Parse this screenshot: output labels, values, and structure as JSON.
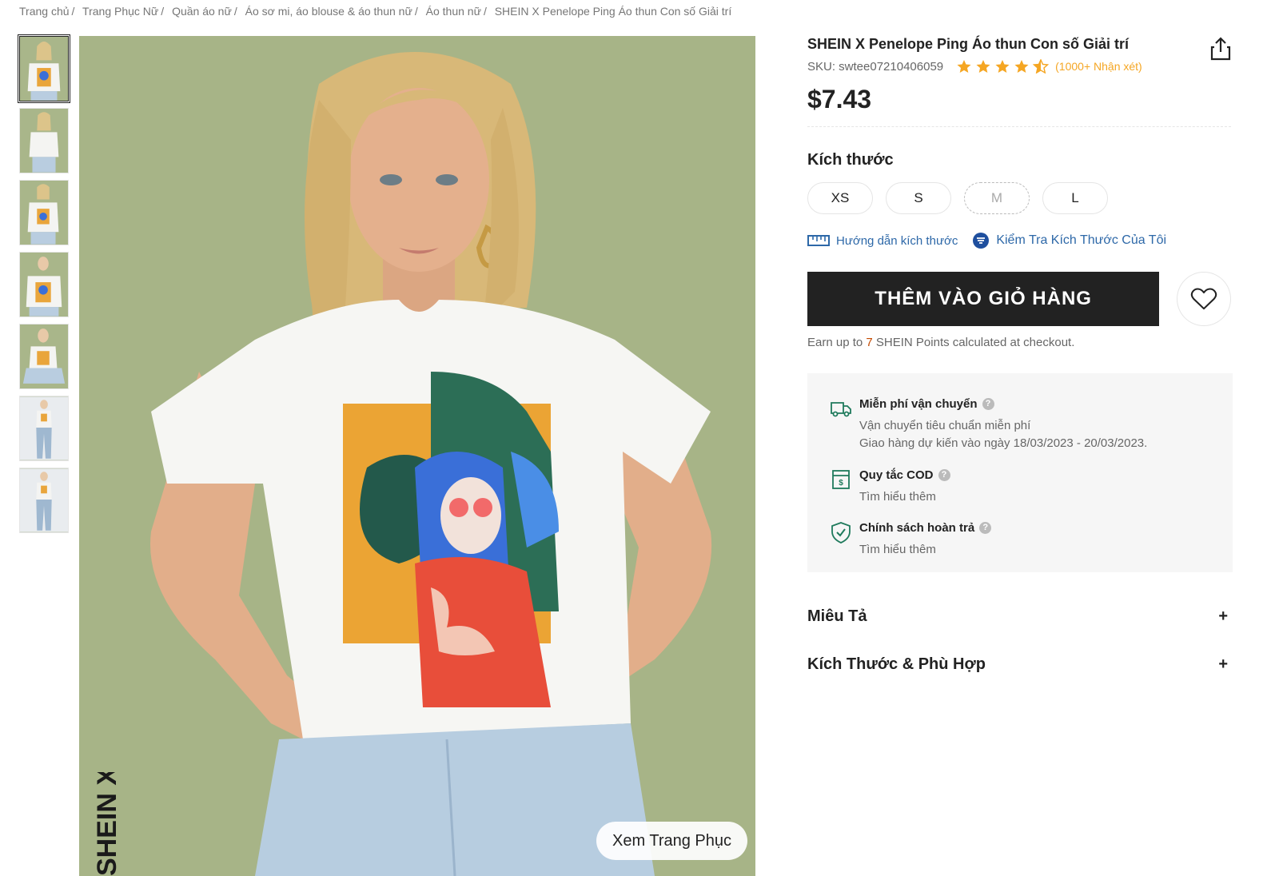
{
  "breadcrumb": {
    "items": [
      "Trang chủ",
      "Trang Phục Nữ",
      "Quần áo nữ",
      "Áo sơ mi, áo blouse & áo thun nữ",
      "Áo thun nữ"
    ],
    "current": "SHEIN X Penelope Ping Áo thun Con số Giải trí"
  },
  "gallery": {
    "thumbnail_count": 7,
    "active_index": 0,
    "brand_logo": "SHEIN X",
    "outfit_button": "Xem Trang Phục"
  },
  "product": {
    "title": "SHEIN X Penelope Ping Áo thun Con số Giải trí",
    "sku_label": "SKU: swtee07210406059",
    "rating": 4.5,
    "reviews": "(1000+ Nhận xét)",
    "price": "$7.43",
    "share_icon": "share-icon"
  },
  "size": {
    "label": "Kích thước",
    "options": [
      {
        "label": "XS",
        "available": true
      },
      {
        "label": "S",
        "available": true
      },
      {
        "label": "M",
        "available": false
      },
      {
        "label": "L",
        "available": true
      }
    ],
    "guide_link": "Hướng dẫn kích thước",
    "check_link": "Kiểm Tra Kích Thước Của Tôi"
  },
  "cart": {
    "add_label": "THÊM VÀO GIỎ HÀNG",
    "wishlist_icon": "heart-icon",
    "points_prefix": "Earn up to",
    "points_value": "7",
    "points_suffix": "SHEIN Points calculated at checkout."
  },
  "services": [
    {
      "icon": "truck-icon",
      "title": "Miễn phí vận chuyển",
      "lines": [
        "Vận chuyển tiêu chuẩn miễn phí",
        "Giao hàng dự kiến vào ngày 18/03/2023 - 20/03/2023."
      ]
    },
    {
      "icon": "cod-icon",
      "title": "Quy tắc COD",
      "lines": [
        "Tìm hiểu thêm"
      ]
    },
    {
      "icon": "shield-check-icon",
      "title": "Chính sách hoàn trả",
      "lines": [
        "Tìm hiểu thêm"
      ]
    }
  ],
  "accordion": [
    {
      "title": "Miêu Tả",
      "icon": "+"
    },
    {
      "title": "Kích Thước & Phù Hợp",
      "icon": "+"
    }
  ],
  "colors": {
    "accent_link": "#2d68a8",
    "star": "#f5a623",
    "points_highlight": "#c44a01",
    "image_bg": "#a7b487"
  }
}
